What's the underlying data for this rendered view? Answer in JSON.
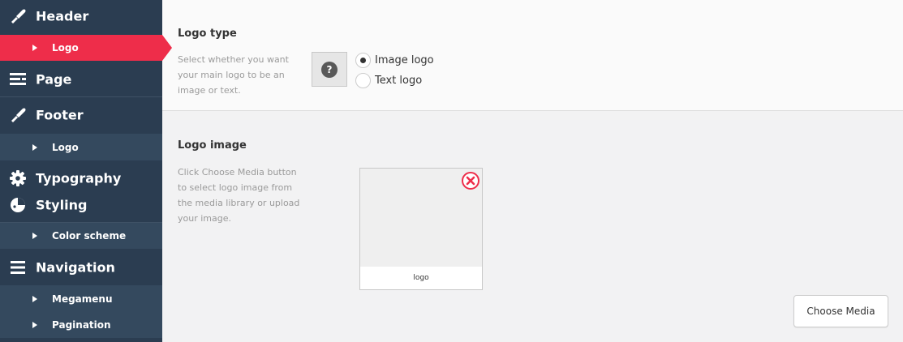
{
  "sidebar": {
    "header_label": "Header",
    "header_logo_label": "Logo",
    "page_label": "Page",
    "footer_label": "Footer",
    "footer_logo_label": "Logo",
    "typography_label": "Typography",
    "styling_label": "Styling",
    "color_scheme_label": "Color scheme",
    "navigation_label": "Navigation",
    "megamenu_label": "Megamenu",
    "pagination_label": "Pagination",
    "active_color": "#ee2d4a",
    "background_color": "#2b3d51"
  },
  "logo_type": {
    "title": "Logo type",
    "description": "Select whether you want your main logo to be an image or text.",
    "help_symbol": "?",
    "options": {
      "image": "Image logo",
      "text": "Text logo"
    },
    "selected": "Image logo"
  },
  "logo_image": {
    "title": "Logo image",
    "description": "Click Choose Media button to select logo image from the media library or upload your image.",
    "caption": "logo",
    "choose_button": "Choose Media"
  }
}
